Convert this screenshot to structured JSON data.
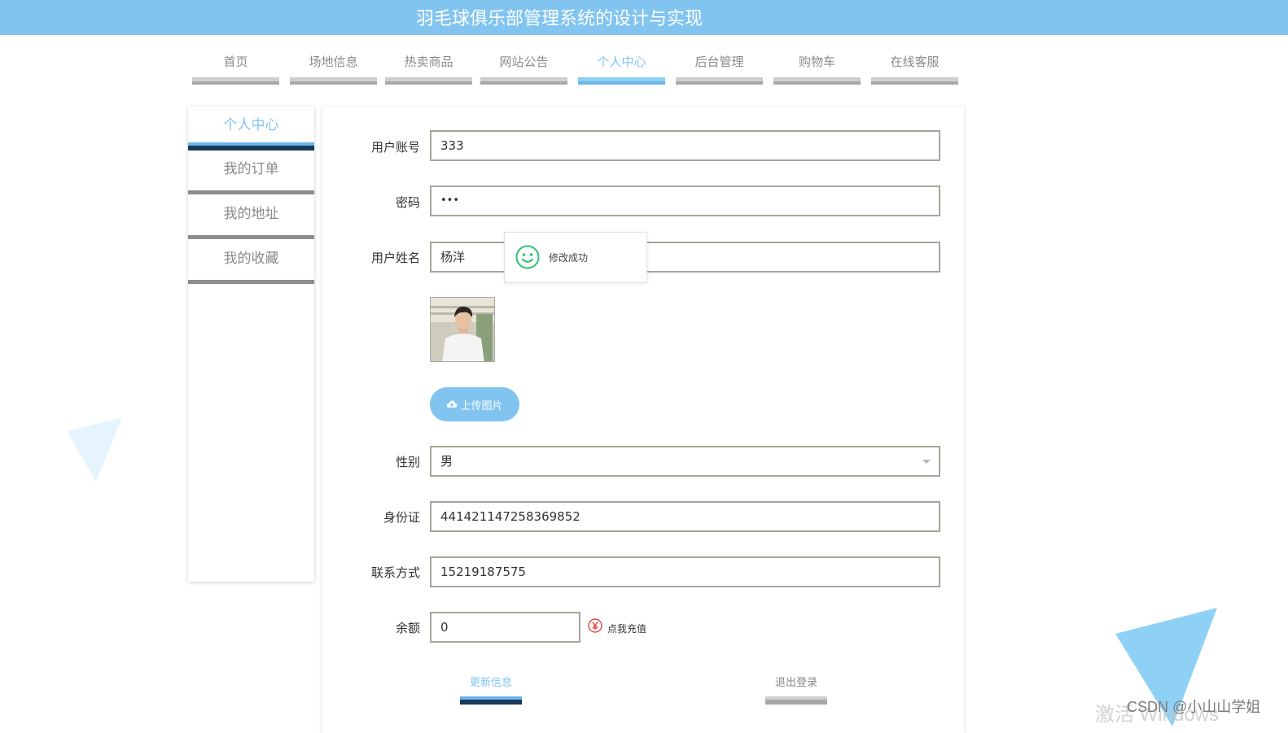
{
  "header": {
    "title": "羽毛球俱乐部管理系统的设计与实现"
  },
  "nav": {
    "items": [
      {
        "label": "首页",
        "active": false
      },
      {
        "label": "场地信息",
        "active": false
      },
      {
        "label": "热卖商品",
        "active": false
      },
      {
        "label": "网站公告",
        "active": false
      },
      {
        "label": "个人中心",
        "active": true
      },
      {
        "label": "后台管理",
        "active": false
      },
      {
        "label": "购物车",
        "active": false
      },
      {
        "label": "在线客服",
        "active": false
      }
    ]
  },
  "sidebar": {
    "items": [
      {
        "label": "个人中心",
        "active": true
      },
      {
        "label": "我的订单",
        "active": false
      },
      {
        "label": "我的地址",
        "active": false
      },
      {
        "label": "我的收藏",
        "active": false
      }
    ]
  },
  "form": {
    "account": {
      "label": "用户账号",
      "value": "333"
    },
    "password": {
      "label": "密码",
      "value": "•••"
    },
    "name": {
      "label": "用户姓名",
      "value": "杨洋"
    },
    "upload_label": "上传图片",
    "gender": {
      "label": "性别",
      "value": "男"
    },
    "id_card": {
      "label": "身份证",
      "value": "441421147258369852"
    },
    "phone": {
      "label": "联系方式",
      "value": "15219187575"
    },
    "balance": {
      "label": "余额",
      "value": "0"
    },
    "recharge_label": "点我充值"
  },
  "toast": {
    "text": "修改成功"
  },
  "actions": {
    "update_label": "更新信息",
    "logout_label": "退出登录"
  },
  "watermarks": {
    "windows": "激活 Windows",
    "csdn": "CSDN @小山山学姐"
  },
  "colors": {
    "accent": "#82c4f0",
    "dark_bar": "#173a58",
    "toast_icon": "#2fbf71",
    "recharge": "#e53935"
  }
}
